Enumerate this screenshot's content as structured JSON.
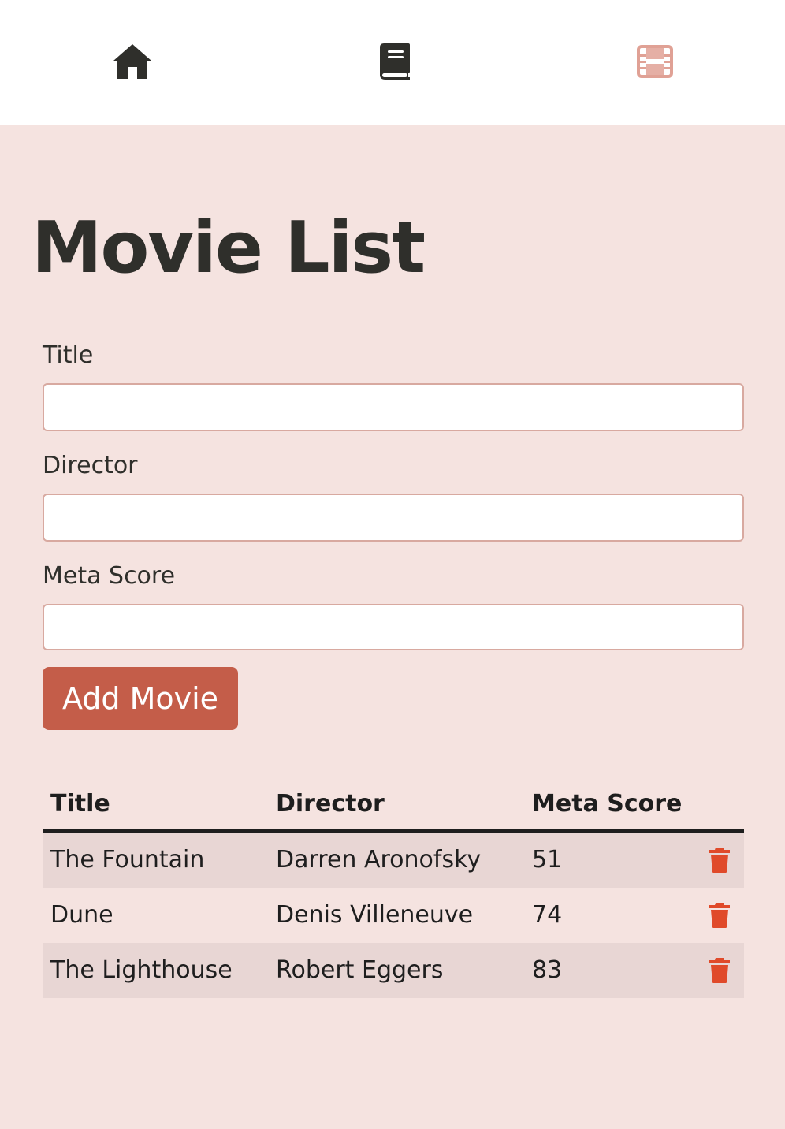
{
  "nav": {
    "items": [
      {
        "icon": "home-icon",
        "label": "Home"
      },
      {
        "icon": "book-icon",
        "label": "Books"
      },
      {
        "icon": "film-icon",
        "label": "Movies",
        "active": true
      }
    ],
    "active_color": "#e0a195",
    "icon_color": "#2f2f2b"
  },
  "page": {
    "title": "Movie List"
  },
  "form": {
    "title_label": "Title",
    "title_value": "",
    "director_label": "Director",
    "director_value": "",
    "score_label": "Meta Score",
    "score_value": "",
    "submit_label": "Add Movie"
  },
  "table": {
    "headers": [
      "Title",
      "Director",
      "Meta Score"
    ],
    "rows": [
      {
        "title": "The Fountain",
        "director": "Darren Aronofsky",
        "score": "51"
      },
      {
        "title": "Dune",
        "director": "Denis Villeneuve",
        "score": "74"
      },
      {
        "title": "The Lighthouse",
        "director": "Robert Eggers",
        "score": "83"
      }
    ],
    "delete_icon": "trash-icon"
  },
  "colors": {
    "background": "#f5e3e0",
    "accent": "#c45d49",
    "delete": "#e04a2a",
    "stripe": "#e8d6d4"
  }
}
